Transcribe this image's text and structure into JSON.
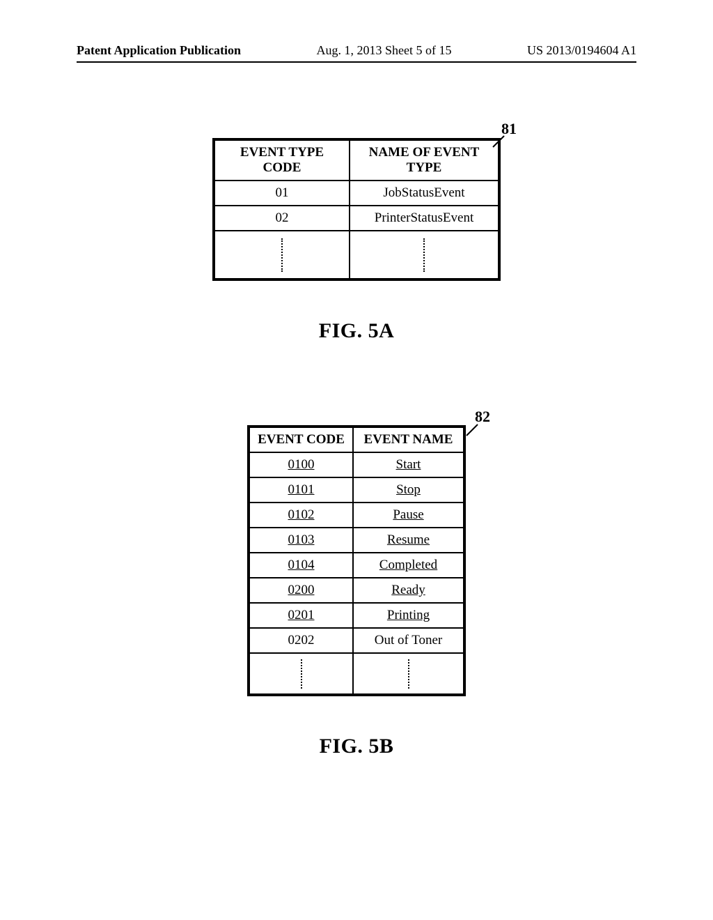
{
  "header": {
    "left": "Patent Application Publication",
    "center": "Aug. 1, 2013  Sheet 5 of 15",
    "right": "US 2013/0194604 A1"
  },
  "figureA": {
    "ref": "81",
    "caption": "FIG. 5A",
    "headers": [
      "EVENT TYPE CODE",
      "NAME OF EVENT TYPE"
    ],
    "rows": [
      {
        "code": "01",
        "name": "JobStatusEvent"
      },
      {
        "code": "02",
        "name": "PrinterStatusEvent"
      }
    ]
  },
  "figureB": {
    "ref": "82",
    "caption": "FIG. 5B",
    "headers": [
      "EVENT CODE",
      "EVENT NAME"
    ],
    "rows": [
      {
        "code": "0100",
        "name": "Start",
        "underline": true
      },
      {
        "code": "0101",
        "name": "Stop",
        "underline": true
      },
      {
        "code": "0102",
        "name": "Pause",
        "underline": true
      },
      {
        "code": "0103",
        "name": "Resume",
        "underline": true
      },
      {
        "code": "0104",
        "name": "Completed",
        "underline": true
      },
      {
        "code": "0200",
        "name": "Ready",
        "underline": true
      },
      {
        "code": "0201",
        "name": "Printing",
        "underline": true
      },
      {
        "code": "0202",
        "name": "Out of Toner",
        "underline": false
      }
    ]
  }
}
